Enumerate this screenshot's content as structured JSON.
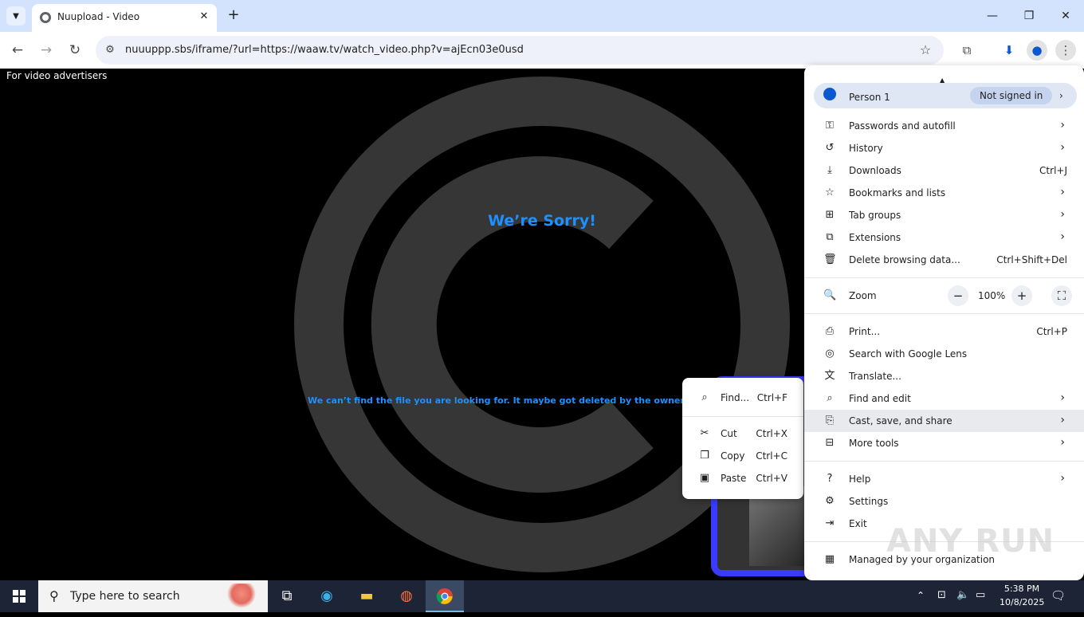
{
  "tab": {
    "title": "Nuupload - Video"
  },
  "toolbar": {
    "url": "nuuuppp.sbs/iframe/?url=https://waaw.tv/watch_video.php?v=ajEcn03e0usd"
  },
  "page": {
    "advertiser_text": "For video advertisers",
    "sorry_heading": "We’re Sorry!",
    "missing_text": "We can’t find the file you are looking for. It maybe got deleted by the owner or was removed d"
  },
  "context_menu": {
    "items": [
      {
        "label": "Find...",
        "shortcut": "Ctrl+F",
        "icon": "find-in-page-icon"
      },
      {
        "label": "Cut",
        "shortcut": "Ctrl+X",
        "icon": "scissors-icon"
      },
      {
        "label": "Copy",
        "shortcut": "Ctrl+C",
        "icon": "copy-icon"
      },
      {
        "label": "Paste",
        "shortcut": "Ctrl+V",
        "icon": "clipboard-icon"
      }
    ]
  },
  "chrome_menu": {
    "profile": {
      "name": "Person 1",
      "status": "Not signed in"
    },
    "items": [
      {
        "label": "Passwords and autofill",
        "icon": "key-icon"
      },
      {
        "label": "History",
        "icon": "history-icon"
      },
      {
        "label": "Downloads",
        "shortcut": "Ctrl+J",
        "icon": "download-icon"
      },
      {
        "label": "Bookmarks and lists",
        "icon": "star-icon"
      },
      {
        "label": "Tab groups",
        "icon": "grid-icon"
      },
      {
        "label": "Extensions",
        "icon": "puzzle-icon"
      },
      {
        "label": "Delete browsing data...",
        "shortcut": "Ctrl+Shift+Del",
        "icon": "trash-icon"
      },
      {
        "label": "Zoom",
        "icon": "zoom-icon"
      },
      {
        "label": "Print...",
        "shortcut": "Ctrl+P",
        "icon": "printer-icon"
      },
      {
        "label": "Search with Google Lens",
        "icon": "lens-icon"
      },
      {
        "label": "Translate...",
        "icon": "translate-icon"
      },
      {
        "label": "Find and edit",
        "icon": "find-in-page-icon"
      },
      {
        "label": "Cast, save, and share",
        "icon": "cast-icon"
      },
      {
        "label": "More tools",
        "icon": "toolbox-icon"
      },
      {
        "label": "Help",
        "icon": "help-icon"
      },
      {
        "label": "Settings",
        "icon": "gear-icon"
      },
      {
        "label": "Exit",
        "icon": "exit-icon"
      },
      {
        "label": "Managed by your organization",
        "icon": "building-icon"
      }
    ],
    "zoom_value": "100%"
  },
  "watermark": "ANY RUN",
  "taskbar": {
    "search_placeholder": "Type here to search",
    "time": "5:38 PM",
    "date": "10/8/2025"
  }
}
